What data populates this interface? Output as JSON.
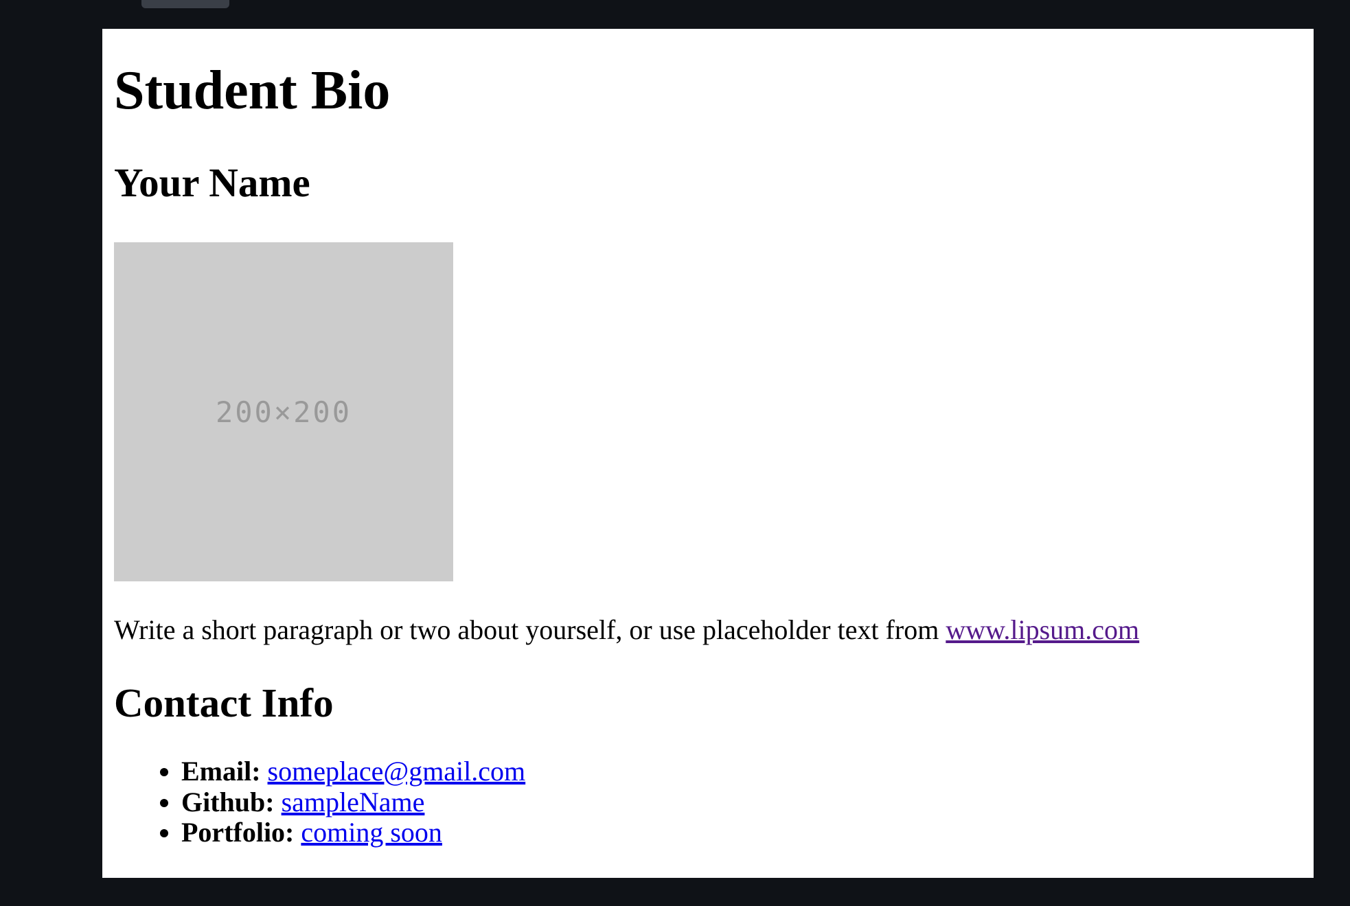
{
  "page": {
    "title": "Student Bio",
    "name_heading": "Your Name",
    "image_placeholder": "200×200",
    "bio_text": "Write a short paragraph or two about yourself, or use placeholder text from ",
    "bio_link": "www.lipsum.com",
    "contact_heading": "Contact Info",
    "contacts": [
      {
        "label": "Email:",
        "value": "someplace@gmail.com"
      },
      {
        "label": "Github:",
        "value": "sampleName"
      },
      {
        "label": "Portfolio:",
        "value": "coming soon"
      }
    ]
  },
  "colors": {
    "background": "#0f1217",
    "link": "#0000ee",
    "visited_link": "#551a8b",
    "placeholder_bg": "#cccccc",
    "placeholder_text": "#999999"
  }
}
